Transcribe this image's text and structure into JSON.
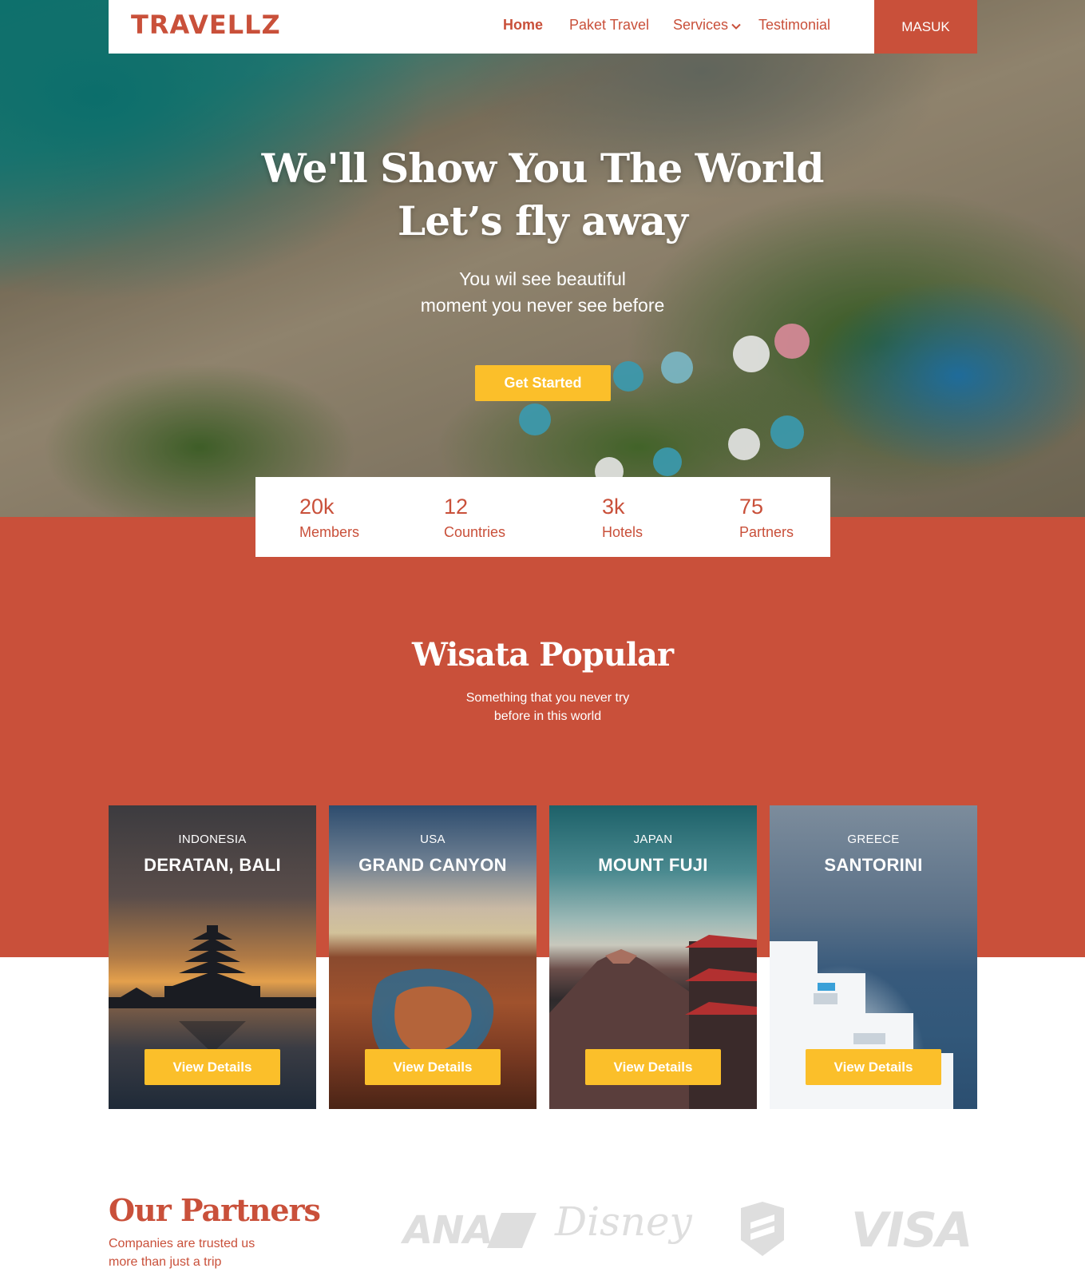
{
  "brand": {
    "logo": "TRAVELLZ",
    "accent": "#c9503a",
    "button_color": "#fbbf2a"
  },
  "nav": {
    "items": [
      {
        "label": "Home"
      },
      {
        "label": "Paket Travel"
      },
      {
        "label": "Services"
      },
      {
        "label": "Testimonial"
      }
    ],
    "login_label": "MASUK"
  },
  "hero": {
    "title_line1": "We'll Show You The World",
    "title_line2": "Let’s fly away",
    "subtitle_line1": "You wil see beautiful",
    "subtitle_line2": "moment you never see before",
    "cta_label": "Get Started"
  },
  "stats": [
    {
      "value": "20k",
      "label": "Members"
    },
    {
      "value": "12",
      "label": "Countries"
    },
    {
      "value": "3k",
      "label": "Hotels"
    },
    {
      "value": "75",
      "label": "Partners"
    }
  ],
  "popular": {
    "title": "Wisata Popular",
    "subtitle_line1": "Something that you never try",
    "subtitle_line2": "before in this world",
    "cards": [
      {
        "country": "INDONESIA",
        "name": "DERATAN, BALI",
        "button": "View Details"
      },
      {
        "country": "USA",
        "name": "GRAND CANYON",
        "button": "View Details"
      },
      {
        "country": "JAPAN",
        "name": "MOUNT FUJI",
        "button": "View Details"
      },
      {
        "country": "GREECE",
        "name": "SANTORINI",
        "button": "View Details"
      }
    ]
  },
  "partners": {
    "title": "Our Partners",
    "subtitle_line1": "Companies are trusted us",
    "subtitle_line2": "more than just a trip",
    "logos": [
      "ANA",
      "Disney",
      "VISA"
    ],
    "icons": [
      "ana-logo-icon",
      "disney-logo-icon",
      "shield-logo-icon",
      "visa-logo-icon"
    ]
  }
}
